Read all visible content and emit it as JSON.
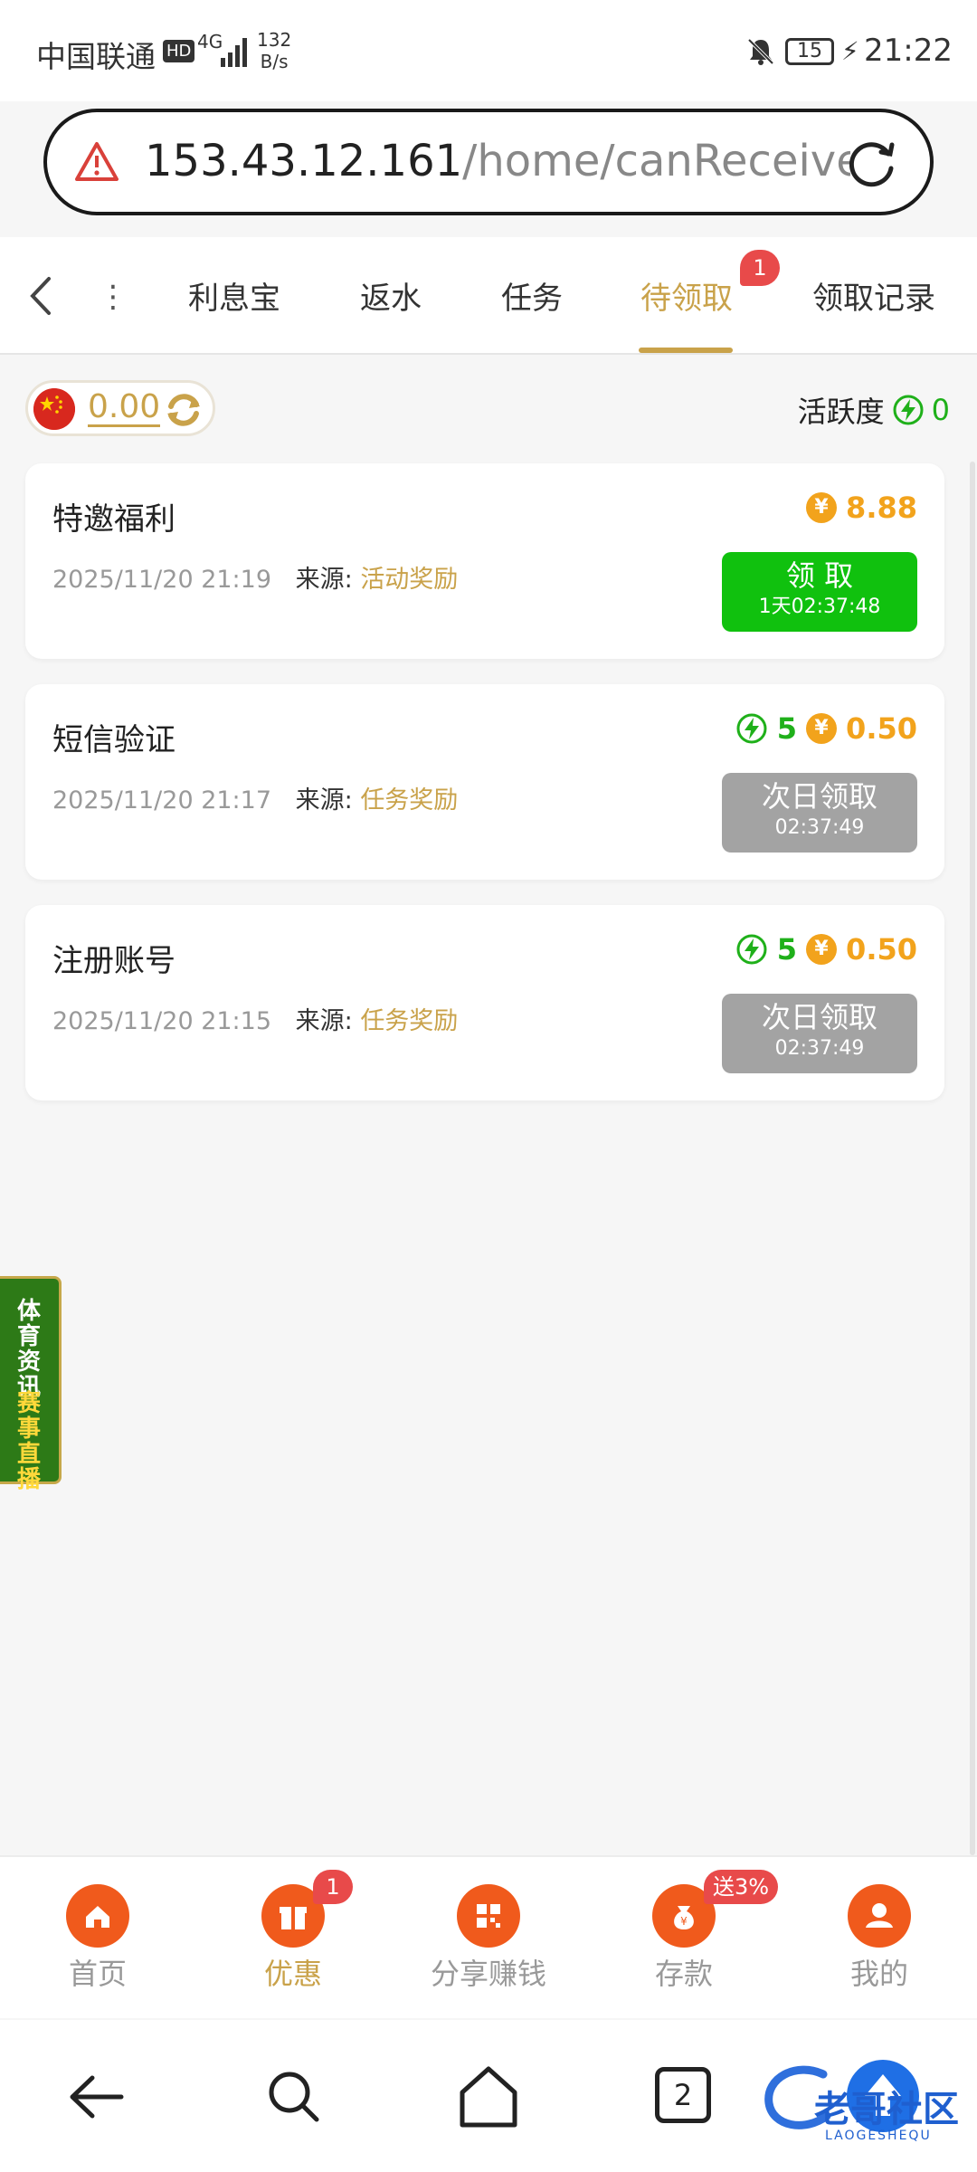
{
  "status_bar": {
    "carrier": "中国联通",
    "hd": "HD",
    "network": "4G",
    "speed_value": "132",
    "speed_unit": "B/s",
    "battery": "15",
    "time": "21:22"
  },
  "browser": {
    "url_host": "153.43.12.161",
    "url_path": "/home/canReceive?c"
  },
  "tabs": {
    "items": [
      {
        "label": "利息宝"
      },
      {
        "label": "返水"
      },
      {
        "label": "任务"
      },
      {
        "label": "待领取",
        "active": true,
        "badge": "1"
      },
      {
        "label": "领取记录"
      }
    ]
  },
  "balance": {
    "amount": "0.00"
  },
  "activity": {
    "label": "活跃度",
    "value": "0"
  },
  "rewards": [
    {
      "title": "特邀福利",
      "time": "2025/11/20 21:19",
      "source_label": "来源:",
      "source": "活动奖励",
      "money": "8.88",
      "button_main": "领 取",
      "button_sub": "1天02:37:48",
      "button_state": "claimable"
    },
    {
      "title": "短信验证",
      "time": "2025/11/20 21:17",
      "source_label": "来源:",
      "source": "任务奖励",
      "points": "5",
      "money": "0.50",
      "button_main": "次日领取",
      "button_sub": "02:37:49",
      "button_state": "disabled"
    },
    {
      "title": "注册账号",
      "time": "2025/11/20 21:15",
      "source_label": "来源:",
      "source": "任务奖励",
      "points": "5",
      "money": "0.50",
      "button_main": "次日领取",
      "button_sub": "02:37:49",
      "button_state": "disabled"
    }
  ],
  "side_banner": {
    "line1": "体育资讯",
    "line2": "赛事直播"
  },
  "bottom_nav": {
    "items": [
      {
        "label": "首页",
        "icon": "home-icon"
      },
      {
        "label": "优惠",
        "icon": "gift-icon",
        "active": true,
        "badge": "1"
      },
      {
        "label": "分享赚钱",
        "icon": "qrcode-icon"
      },
      {
        "label": "存款",
        "icon": "moneybag-icon",
        "badge": "送3%"
      },
      {
        "label": "我的",
        "icon": "user-icon"
      }
    ]
  },
  "system_nav": {
    "tab_count": "2",
    "watermark": "老哥社区",
    "watermark_sub": "LAOGESHEQU"
  },
  "colors": {
    "accent_gold": "#c9a24a",
    "green": "#10c10e",
    "orange": "#f05a1c",
    "coin": "#f2a31c",
    "badge_red": "#e84a4a"
  }
}
